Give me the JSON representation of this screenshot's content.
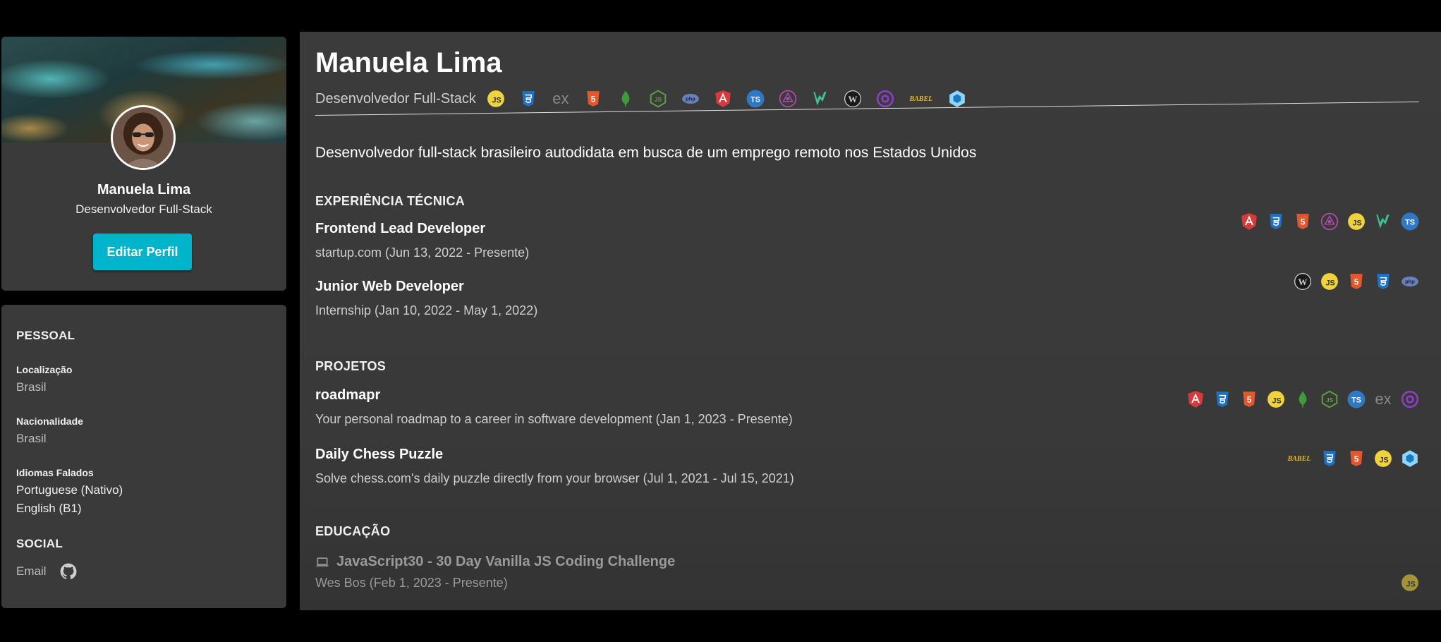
{
  "profile": {
    "name": "Manuela Lima",
    "role": "Desenvolvedor Full-Stack",
    "edit_label": "Editar Perfil"
  },
  "personal": {
    "title": "PESSOAL",
    "location_label": "Localização",
    "location": "Brasil",
    "nationality_label": "Nacionalidade",
    "nationality": "Brasil",
    "languages_label": "Idiomas Falados",
    "languages": [
      "Portuguese (Nativo)",
      "English (B1)"
    ]
  },
  "social": {
    "title": "SOCIAL",
    "email_label": "Email",
    "github_icon": "github-icon"
  },
  "header": {
    "name": "Manuela Lima",
    "role": "Desenvolvedor Full-Stack",
    "tech_icons": [
      "javascript",
      "css3",
      "express",
      "html5",
      "mongodb",
      "nodejs",
      "php",
      "angular",
      "typescript",
      "graphql",
      "vue",
      "wordpress",
      "redux",
      "babel",
      "webpack"
    ],
    "summary": "Desenvolvedor full-stack brasileiro autodidata em busca de um emprego remoto nos Estados Unidos"
  },
  "experience": {
    "title": "EXPERIÊNCIA TÉCNICA",
    "items": [
      {
        "title": "Frontend Lead Developer",
        "subtitle": "startup.com (Jun 13, 2022 - Presente)",
        "icons": [
          "angular",
          "css3",
          "html5",
          "graphql",
          "javascript",
          "vue",
          "typescript"
        ]
      },
      {
        "title": "Junior Web Developer",
        "subtitle": "Internship (Jan 10, 2022 - May 1, 2022)",
        "icons": [
          "wordpress",
          "javascript",
          "html5",
          "css3",
          "php"
        ]
      }
    ]
  },
  "projects": {
    "title": "PROJETOS",
    "items": [
      {
        "title": "roadmapr",
        "subtitle": "Your personal roadmap to a career in software development (Jan 1, 2023 - Presente)",
        "icons": [
          "angular",
          "css3",
          "html5",
          "javascript",
          "mongodb",
          "nodejs",
          "typescript",
          "express",
          "redux"
        ]
      },
      {
        "title": "Daily Chess Puzzle",
        "subtitle": "Solve chess.com's daily puzzle directly from your browser (Jul 1, 2021 - Jul 15, 2021)",
        "icons": [
          "babel",
          "css3",
          "html5",
          "javascript",
          "webpack"
        ]
      }
    ]
  },
  "education": {
    "title": "EDUCAÇÃO",
    "items": [
      {
        "title": "JavaScript30 - 30 Day Vanilla JS Coding Challenge",
        "subtitle": "Wes Bos (Feb 1, 2023 - Presente)",
        "icon": "laptop-icon",
        "icons": [
          "javascript"
        ]
      }
    ]
  },
  "colors": {
    "accent": "#00b4cc",
    "panel": "#3a3a3a",
    "background": "#000000"
  },
  "icon_text": {
    "express": "ex",
    "babel": "BABEL"
  }
}
